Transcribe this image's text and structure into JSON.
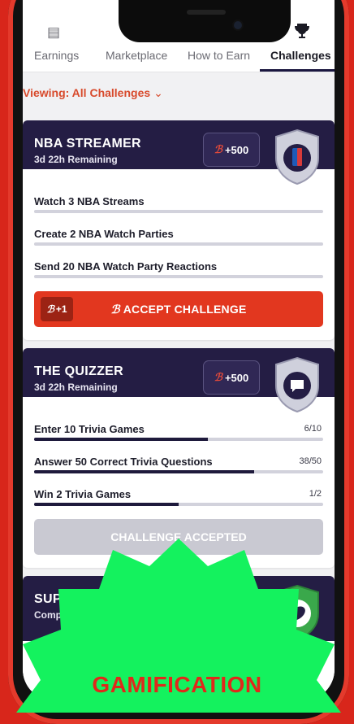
{
  "nav": {
    "tabs": [
      {
        "label": "Earnings"
      },
      {
        "label": "Marketplace"
      },
      {
        "label": "How to Earn"
      },
      {
        "label": "Challenges",
        "active": true
      }
    ]
  },
  "filter": {
    "label": "Viewing: All Challenges"
  },
  "challenges": [
    {
      "title": "NBA STREAMER",
      "remaining": "3d 22h Remaining",
      "reward": "+500",
      "badge_icon": "nba-shield-icon",
      "tasks": [
        {
          "label": "Watch 3 NBA Streams",
          "progress": 0
        },
        {
          "label": "Create 2 NBA Watch Parties",
          "progress": 0
        },
        {
          "label": "Send 20 NBA Watch Party Reactions",
          "progress": 0
        }
      ],
      "button": {
        "plus": "+1",
        "label": "ACCEPT CHALLENGE"
      }
    },
    {
      "title": "THE QUIZZER",
      "remaining": "3d 22h Remaining",
      "reward": "+500",
      "badge_icon": "chat-bubble-shield-icon",
      "tasks": [
        {
          "label": "Enter 10 Trivia Games",
          "count": "6/10",
          "progress": 0.6
        },
        {
          "label": "Answer 50 Correct Trivia Questions",
          "count": "38/50",
          "progress": 0.76
        },
        {
          "label": "Win 2 Trivia Games",
          "count": "1/2",
          "progress": 0.5
        }
      ],
      "button": {
        "label": "CHALLENGE ACCEPTED"
      }
    },
    {
      "title": "SUPER",
      "remaining": "Compl",
      "badge_icon": "football-shield-icon"
    }
  ],
  "overlay": {
    "label": "GAMIFICATION"
  },
  "colors": {
    "accent": "#e2371f",
    "header": "#241d44",
    "overlay": "#14f25e"
  }
}
